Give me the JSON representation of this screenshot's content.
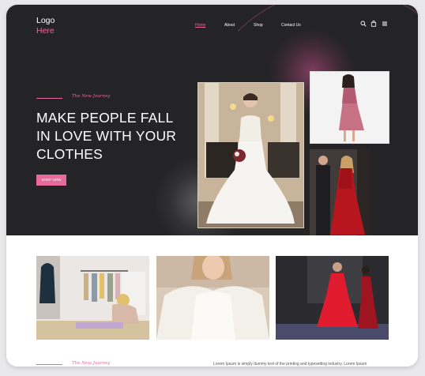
{
  "brand": {
    "logo_line1": "Logo",
    "logo_line2": "Here",
    "accent": "#e8699c",
    "dark_bg": "#242325"
  },
  "nav": {
    "items": [
      {
        "label": "Home",
        "active": true
      },
      {
        "label": "About",
        "active": false
      },
      {
        "label": "Shop",
        "active": false
      },
      {
        "label": "Contact Us",
        "active": false
      }
    ],
    "icons": [
      "search-icon",
      "shopping-bag-icon",
      "menu-icon"
    ]
  },
  "hero": {
    "tagline": "The New Journey",
    "headline_lines": [
      "MAKE PEOPLE FALL",
      "IN LOVE WITH YOUR",
      "CLOTHES"
    ],
    "cta_label": "SHOP NOW"
  },
  "footer": {
    "tagline": "The New Journey",
    "text": "Lorem Ipsum is simply dummy text of the printing and typesetting industry. Lorem Ipsum"
  }
}
